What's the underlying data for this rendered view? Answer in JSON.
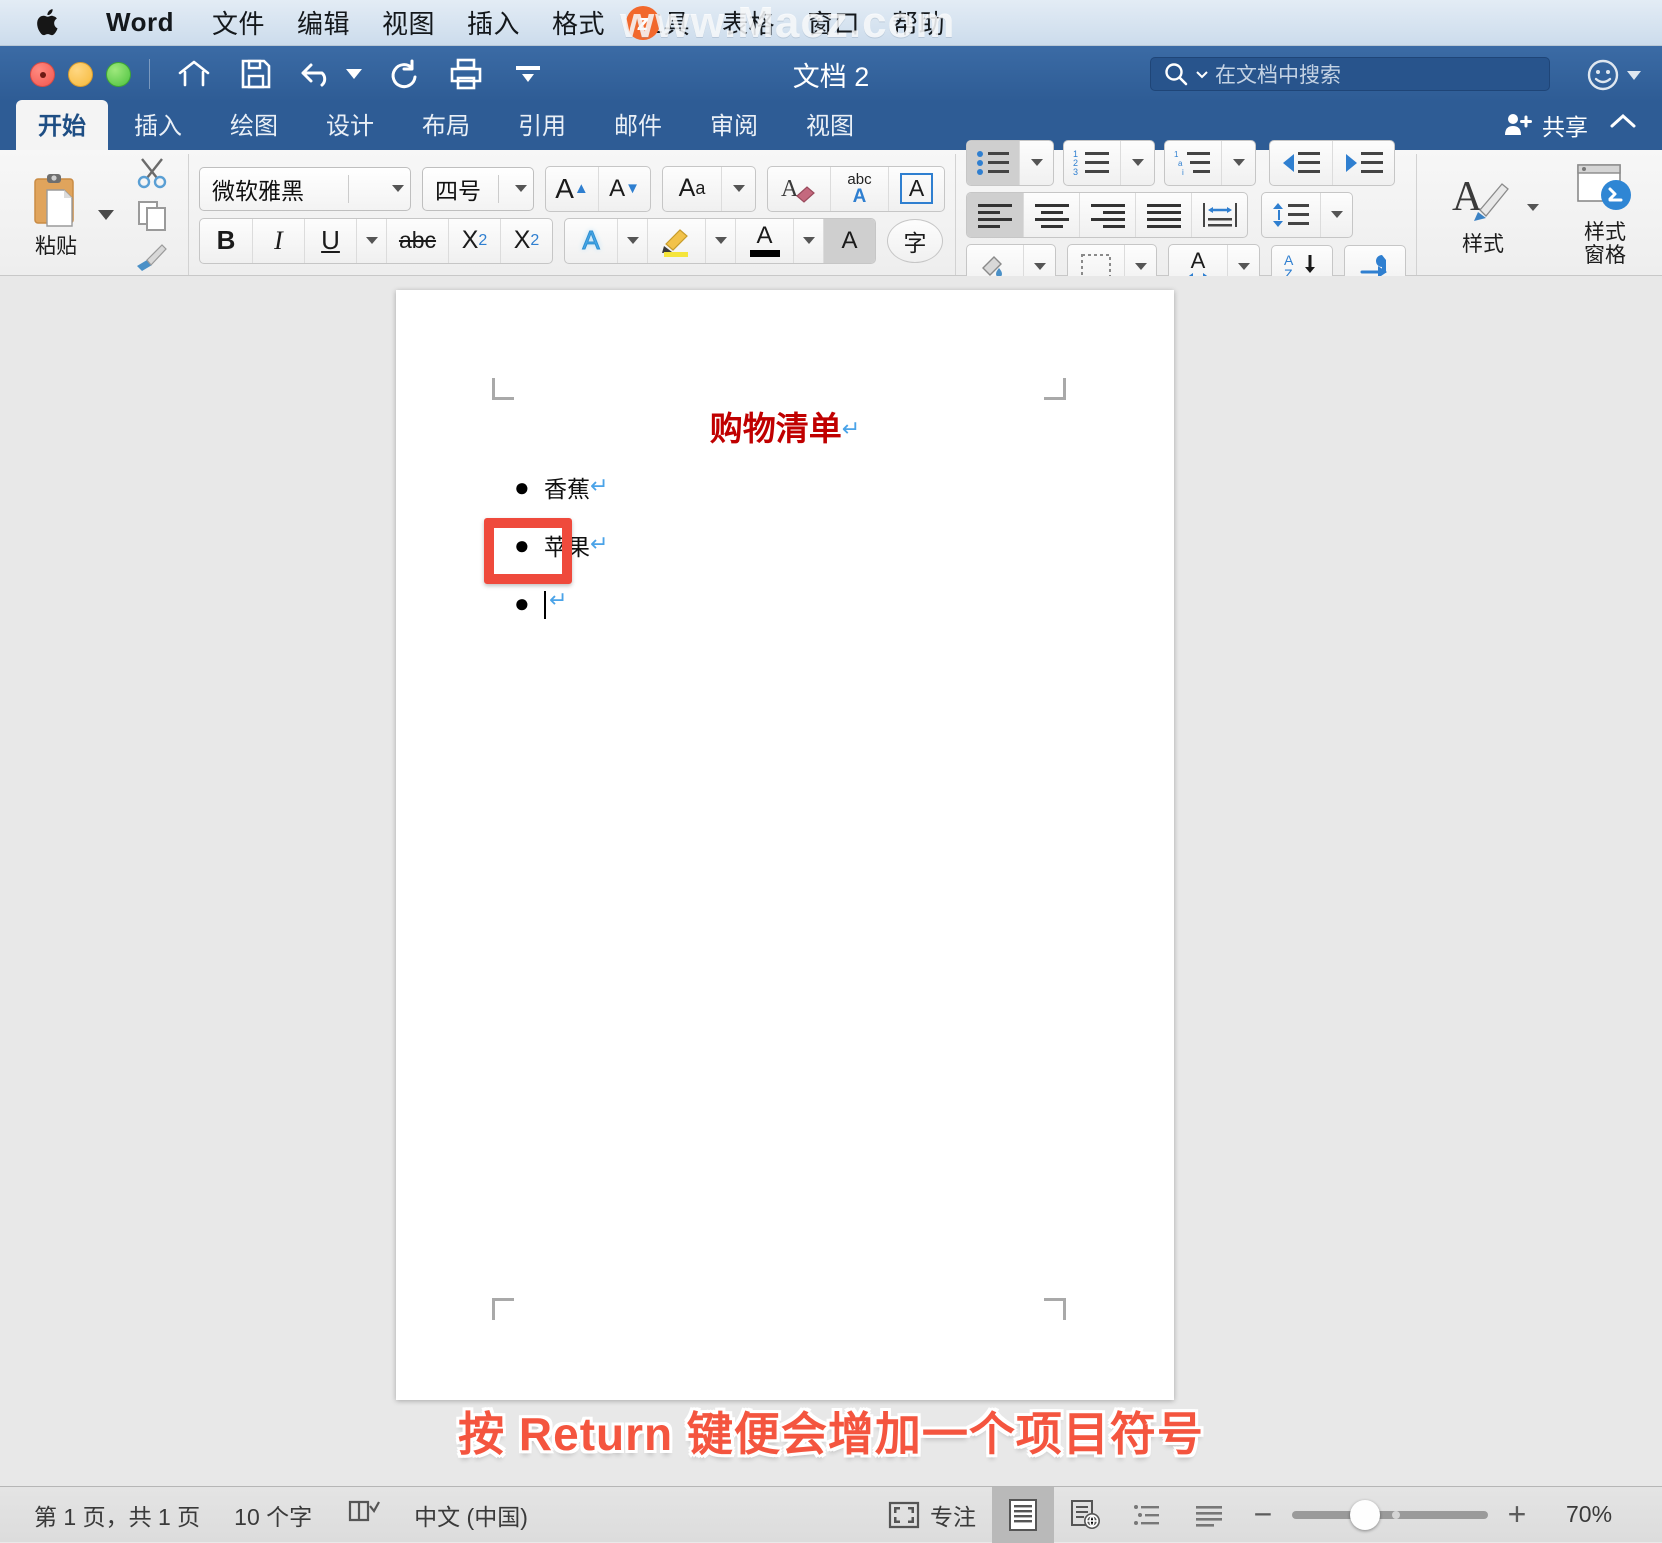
{
  "menubar": {
    "apple_icon": "apple-logo",
    "items": [
      {
        "label": "Word",
        "bold": true
      },
      {
        "label": "文件",
        "bold": false
      },
      {
        "label": "编辑",
        "bold": false
      },
      {
        "label": "视图",
        "bold": false
      },
      {
        "label": "插入",
        "bold": false
      },
      {
        "label": "格式",
        "bold": false
      },
      {
        "label": "工具",
        "bold": false
      },
      {
        "label": "表格",
        "bold": false
      },
      {
        "label": "窗口",
        "bold": false
      },
      {
        "label": "帮助",
        "bold": false
      }
    ],
    "watermark": "www.Macz.com",
    "watermark_badge": "z"
  },
  "titlebar": {
    "document_title": "文档 2",
    "quick_access": [
      {
        "name": "home-icon"
      },
      {
        "name": "save-icon"
      },
      {
        "name": "undo-icon"
      },
      {
        "name": "redo-icon"
      },
      {
        "name": "print-icon"
      },
      {
        "name": "customize-toolbar-icon"
      }
    ],
    "search_placeholder": "在文档中搜索",
    "search_value": ""
  },
  "ribbon_tabs": {
    "tabs": [
      {
        "label": "开始",
        "active": true
      },
      {
        "label": "插入",
        "active": false
      },
      {
        "label": "绘图",
        "active": false
      },
      {
        "label": "设计",
        "active": false
      },
      {
        "label": "布局",
        "active": false
      },
      {
        "label": "引用",
        "active": false
      },
      {
        "label": "邮件",
        "active": false
      },
      {
        "label": "审阅",
        "active": false
      },
      {
        "label": "视图",
        "active": false
      }
    ],
    "share_label": "共享"
  },
  "ribbon": {
    "clipboard": {
      "paste_label": "粘贴",
      "cut_name": "scissors-icon",
      "copy_name": "copy-icon",
      "format_painter_name": "format-painter-icon"
    },
    "font": {
      "font_name": "微软雅黑",
      "font_size": "四号",
      "grow_font": "A▲",
      "shrink_font": "A▼",
      "change_case": "Aa",
      "clear_formatting": "clear-formatting-icon",
      "spelling": "abc",
      "character_border": "A",
      "bold": "B",
      "italic": "I",
      "underline": "U",
      "strikethrough": "abc",
      "subscript": "X₂",
      "superscript": "X²",
      "text_effects": "A",
      "highlight": "highlighter-icon",
      "font_color": "A",
      "shading": "A",
      "asian_layout": "字"
    },
    "paragraph": {
      "bullets": "bullet-list-icon",
      "numbering": "numbered-list-icon",
      "multilevel": "multilevel-list-icon",
      "decrease_indent": "decrease-indent-icon",
      "increase_indent": "increase-indent-icon",
      "align_left": "align-left-icon",
      "align_center": "align-center-icon",
      "align_right": "align-right-icon",
      "justify": "justify-icon",
      "distributed": "distributed-icon",
      "line_spacing": "line-spacing-icon",
      "shading_fill": "shading-icon",
      "borders": "borders-icon",
      "text_direction": "text-direction-icon",
      "sort": "sort-icon",
      "show_marks": "show-paragraph-marks-icon",
      "active_button": "bullets"
    },
    "styles": {
      "styles_label": "样式",
      "styles_pane_label": "样式\n窗格"
    }
  },
  "document": {
    "title_text": "购物清单",
    "paragraph_mark": "↵",
    "bullets": [
      {
        "text": "香蕉",
        "mark": "↵",
        "empty": false
      },
      {
        "text": "苹果",
        "mark": "↵",
        "empty": false
      },
      {
        "text": "",
        "mark": "↵",
        "empty": true
      }
    ],
    "bullet_char": "●",
    "highlight_color": "#ef4a3c",
    "title_color": "#c00000",
    "annotation": "按 Return 键便会增加一个项目符号",
    "annotation_color": "#f4553f"
  },
  "statusbar": {
    "page_info": "第 1 页，共 1 页",
    "word_count": "10 个字",
    "proofing_icon": "proofing-check-icon",
    "language": "中文 (中国)",
    "focus_label": "专注",
    "views": [
      {
        "name": "print-layout-view",
        "active": true
      },
      {
        "name": "web-layout-view",
        "active": false
      },
      {
        "name": "outline-view",
        "active": false
      },
      {
        "name": "draft-view",
        "active": false
      }
    ],
    "zoom_minus": "−",
    "zoom_plus": "+",
    "zoom_value": "70%"
  }
}
